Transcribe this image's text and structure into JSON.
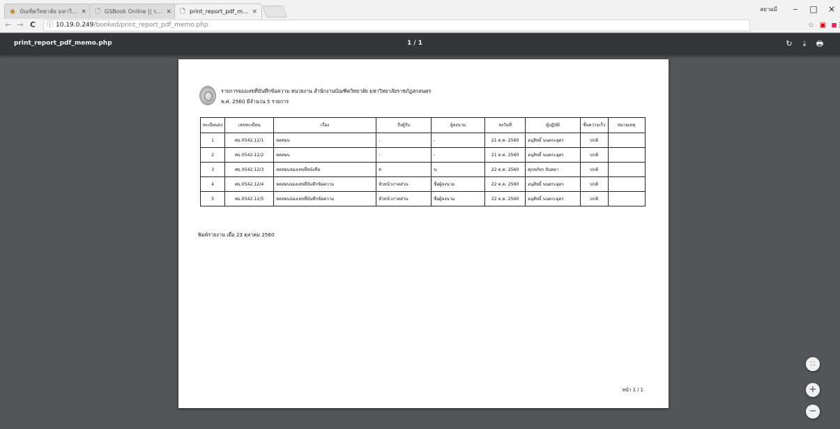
{
  "browser": {
    "tabs": [
      {
        "title": "บัณฑิตวิทยาลัย มหาวิทยาลัย",
        "icon": "university-icon",
        "active": false
      },
      {
        "title": "GSBook Online || ระบบจอ",
        "icon": "page-icon",
        "active": false
      },
      {
        "title": "print_report_pdf_memo.p",
        "icon": "page-icon",
        "active": true
      }
    ],
    "close_glyph": "×",
    "user_label": "สยามมี",
    "window_buttons": {
      "minimize": "–",
      "maximize": "□",
      "close": "×"
    },
    "address": {
      "info_glyph": "ⓘ",
      "host": "10.19.0.249",
      "path": "/booked/print_report_pdf_memo.php"
    },
    "nav": {
      "back": "←",
      "forward": "→",
      "reload": "C"
    },
    "toolbar_icons": {
      "star": "☆",
      "ext1": "▣",
      "ext2": "◼",
      "menu": "⋮"
    }
  },
  "pdf_viewer": {
    "title": "print_report_pdf_memo.php",
    "page_indicator": "1 / 1",
    "tools": {
      "rotate": "↻",
      "download": "⤓",
      "print": "🖶"
    },
    "zoom": {
      "fit": "⛶",
      "in": "+",
      "out": "−"
    }
  },
  "report": {
    "title": "รายการจองเลขที่บันทึกข้อความ หน่วยงาน สำนักงานบัณฑิตวิทยาลัย มหาวิทยาลัยราชภัฏสกลนคร",
    "subtitle": "พ.ศ. 2560 มีจำนวน 5 รายการ",
    "headers": [
      "ทะเบียนลง",
      "เลขทะเบียน",
      "เรื่อง",
      "ถึงผู้รับ",
      "ผู้ลงนาม",
      "ลงวันที่",
      "ผู้ปฏิบัติ",
      "ชั้นความเร็ว",
      "หมายเหตุ"
    ],
    "rows": [
      [
        "1",
        "ศธ.0542.12/1",
        "ทดสอบ",
        "-",
        "-",
        "21 ต.ค. 2560",
        "อนุสิทธิ์ นนตระอุตร",
        "ปกติ",
        ""
      ],
      [
        "2",
        "ศธ.0542.12/2",
        "ทดสอบ",
        "-",
        "-",
        "21 ต.ค. 2560",
        "อนุสิทธิ์ นนตระอุตร",
        "ปกติ",
        ""
      ],
      [
        "3",
        "ศธ.0542.12/3",
        "ทดสอบจองเลขที่หนังสือ",
        "ส",
        "น",
        "22 ต.ค. 2560",
        "ศุภลภัทร จันทยา",
        "ปกติ",
        ""
      ],
      [
        "4",
        "ศธ.0542.12/4",
        "ทดสอบจองเลขที่บันทึกข้อความ",
        "หัวหน้าภาคส่วน",
        "ชื่อผู้ลงนาม",
        "22 ต.ค. 2560",
        "อนุสิทธิ์ นนตระอุตร",
        "ปกติ",
        ""
      ],
      [
        "5",
        "ศธ.0542.12/5",
        "ทดสอบจองเลขที่บันทึกข้อความ",
        "หัวหน้าภาคส่วน",
        "ชื่อผู้ลงนาม",
        "22 ต.ค. 2560",
        "อนุสิทธิ์ นนตระอุตร",
        "ปกติ",
        ""
      ]
    ],
    "printed_on": "พิมพ์รายงาน เมื่อ 23 ตุลาคม 2560",
    "page_footer": "หน้า 1 / 1"
  }
}
